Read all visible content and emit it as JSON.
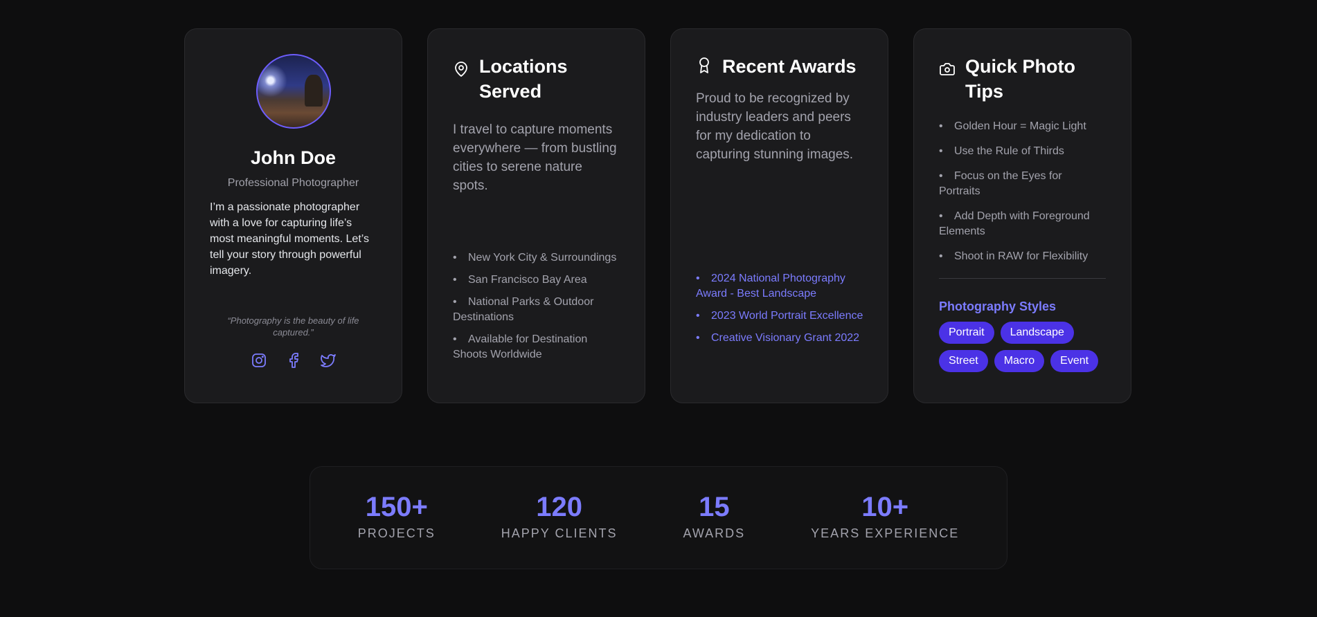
{
  "profile": {
    "name": "John Doe",
    "role": "Professional Photographer",
    "bio": "I’m a passionate photographer with a love for capturing life’s most meaningful moments. Let’s tell your story through powerful imagery.",
    "quote": "“Photography is the beauty of life captured.”",
    "social_icons": [
      "instagram-icon",
      "facebook-icon",
      "twitter-icon"
    ]
  },
  "locations": {
    "icon": "map-pin-icon",
    "title": "Locations Served",
    "description": "I travel to capture moments everywhere — from bustling cities to serene nature spots.",
    "items": [
      "New York City & Surroundings",
      "San Francisco Bay Area",
      "National Parks & Outdoor Destinations",
      "Available for Destination Shoots Worldwide"
    ]
  },
  "awards": {
    "icon": "award-icon",
    "title": "Recent Awards",
    "description": "Proud to be recognized by industry leaders and peers for my dedication to capturing stunning images.",
    "items": [
      "2024 National Photography Award - Best Landscape",
      "2023 World Portrait Excellence",
      "Creative Visionary Grant 2022"
    ]
  },
  "tips": {
    "icon": "camera-icon",
    "title": "Quick Photo Tips",
    "items": [
      "Golden Hour = Magic Light",
      "Use the Rule of Thirds",
      "Focus on the Eyes for Portraits",
      "Add Depth with Foreground Elements",
      "Shoot in RAW for Flexibility"
    ],
    "styles_title": "Photography Styles",
    "styles": [
      "Portrait",
      "Landscape",
      "Street",
      "Macro",
      "Event"
    ]
  },
  "stats": [
    {
      "value": "150+",
      "label": "PROJECTS"
    },
    {
      "value": "120",
      "label": "HAPPY CLIENTS"
    },
    {
      "value": "15",
      "label": "AWARDS"
    },
    {
      "value": "10+",
      "label": "YEARS EXPERIENCE"
    }
  ],
  "colors": {
    "accent": "#7c7cff",
    "chip": "#4b32e6",
    "background": "#0e0e0f",
    "card": "#1b1b1d"
  }
}
